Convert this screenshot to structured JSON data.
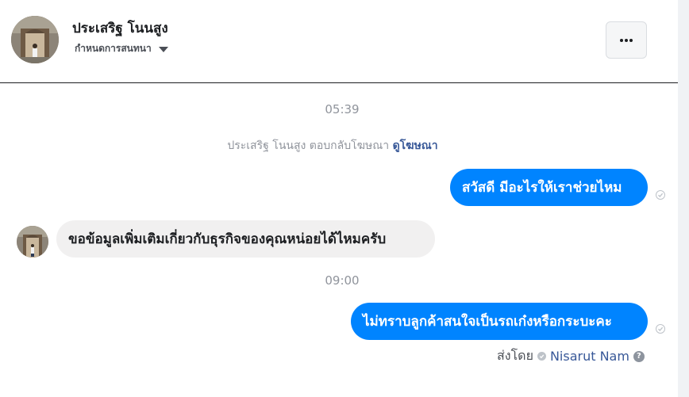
{
  "header": {
    "contact_name": "ประเสริฐ โนนสูง",
    "nickname_label": "กำหนดการสนทนา"
  },
  "conversation": {
    "timestamp_1": "05:39",
    "ad_reply": {
      "text": "ประเสริฐ โนนสูง ตอบกลับโฆษณา ",
      "link": "ดูโฆษณา"
    },
    "messages": [
      {
        "direction": "outgoing",
        "text": "สวัสดี มีอะไรให้เราช่วยไหม"
      },
      {
        "direction": "incoming",
        "text": "ขอข้อมูลเพิ่มเติมเกี่ยวกับธุรกิจของคุณหน่อยได้ไหมครับ"
      },
      {
        "direction": "outgoing",
        "text": "ไม่ทราบลูกค้าสนใจเป็นรถเก๋งหรือกระบะคะ"
      }
    ],
    "timestamp_2": "09:00",
    "sent_by": {
      "label": "ส่งโดย",
      "author": "Nisarut Nam"
    }
  },
  "colors": {
    "outgoing_bubble": "#0084ff",
    "incoming_bubble": "#f1f0f0",
    "link": "#385898"
  },
  "icons": [
    "more-options-icon",
    "dropdown-caret-icon",
    "delivered-check-icon",
    "help-icon"
  ]
}
